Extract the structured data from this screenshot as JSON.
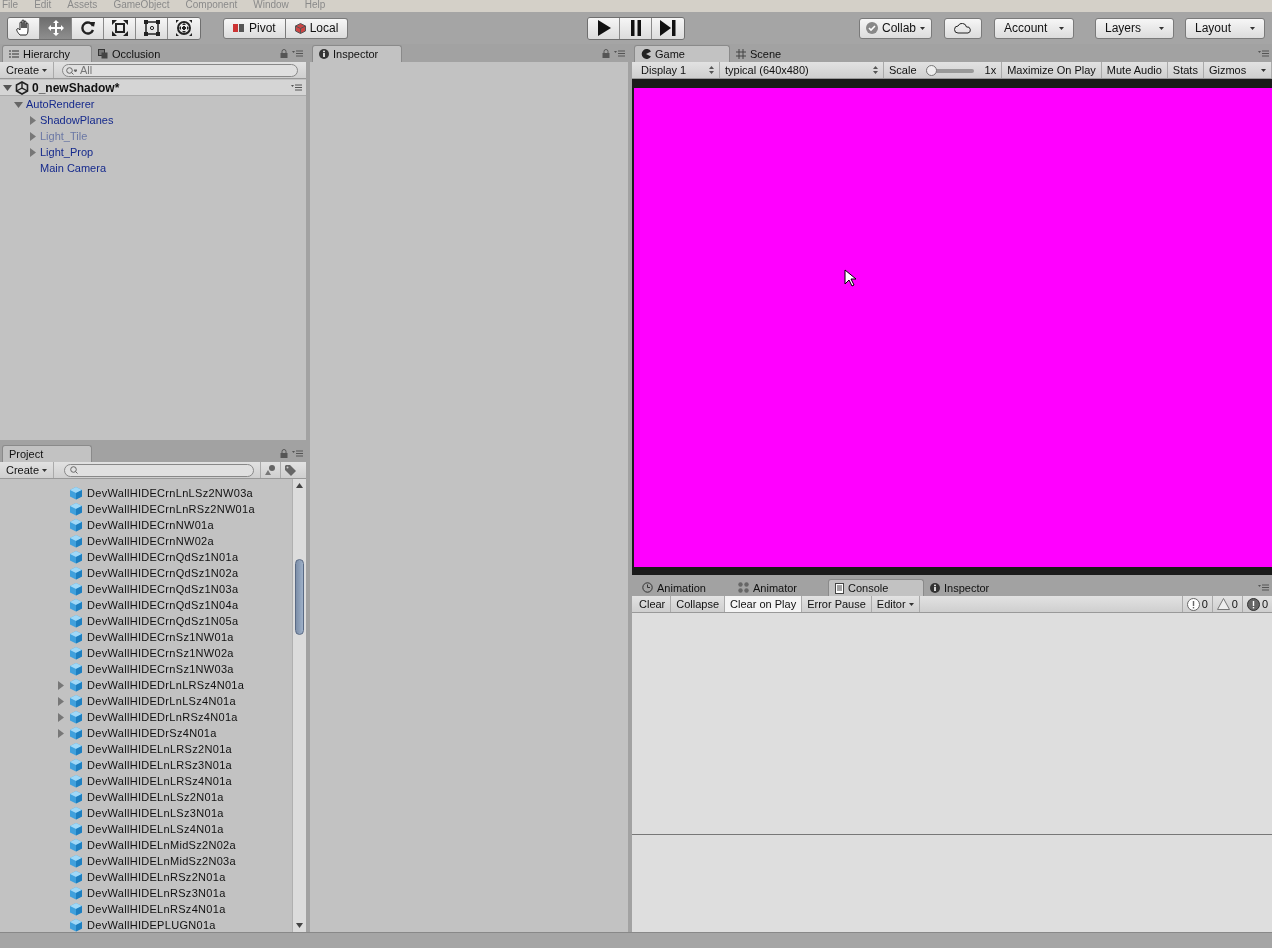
{
  "menu": [
    "File",
    "Edit",
    "Assets",
    "GameObject",
    "Component",
    "Window",
    "Help"
  ],
  "toolbar": {
    "tools": [
      {
        "kind": "hand",
        "selected": false
      },
      {
        "kind": "move",
        "selected": true
      },
      {
        "kind": "rotate",
        "selected": false
      },
      {
        "kind": "scale",
        "selected": false
      },
      {
        "kind": "rect",
        "selected": false
      },
      {
        "kind": "transform",
        "selected": false
      }
    ],
    "pivot": "Pivot",
    "local": "Local",
    "playback": [
      {
        "kind": "play",
        "selected": false
      },
      {
        "kind": "pause",
        "selected": false
      },
      {
        "kind": "step",
        "selected": false
      }
    ],
    "collab": "Collab",
    "account": "Account",
    "layers": "Layers",
    "layout": "Layout"
  },
  "hierarchy": {
    "tabs": [
      {
        "label": "Hierarchy",
        "kind": "list",
        "selected": true
      },
      {
        "label": "Occlusion",
        "kind": "occlusion",
        "selected": false
      }
    ],
    "create": "Create",
    "placeholder": "All",
    "scene": {
      "name": "0_newShadow*",
      "expanded": true,
      "children": [
        {
          "name": "AutoRenderer",
          "kind": "parent",
          "expanded": true,
          "disabled": false,
          "children": [
            {
              "name": "ShadowPlanes",
              "kind": "parent",
              "expanded": false,
              "disabled": false
            },
            {
              "name": "Light_Tile",
              "kind": "parent",
              "expanded": false,
              "disabled": true
            },
            {
              "name": "Light_Prop",
              "kind": "parent",
              "expanded": false,
              "disabled": false
            },
            {
              "name": "Main Camera",
              "kind": "leaf",
              "disabled": false
            }
          ]
        }
      ]
    }
  },
  "project": {
    "tabs": [
      {
        "label": "Project",
        "selected": true
      }
    ],
    "create": "Create",
    "items": [
      {
        "name": "DevWallHIDECrnLnLSz2NW03a",
        "kind": "leaf"
      },
      {
        "name": "DevWallHIDECrnLnRSz2NW01a",
        "kind": "leaf"
      },
      {
        "name": "DevWallHIDECrnNW01a",
        "kind": "leaf"
      },
      {
        "name": "DevWallHIDECrnNW02a",
        "kind": "leaf"
      },
      {
        "name": "DevWallHIDECrnQdSz1N01a",
        "kind": "leaf"
      },
      {
        "name": "DevWallHIDECrnQdSz1N02a",
        "kind": "leaf"
      },
      {
        "name": "DevWallHIDECrnQdSz1N03a",
        "kind": "leaf"
      },
      {
        "name": "DevWallHIDECrnQdSz1N04a",
        "kind": "leaf"
      },
      {
        "name": "DevWallHIDECrnQdSz1N05a",
        "kind": "leaf"
      },
      {
        "name": "DevWallHIDECrnSz1NW01a",
        "kind": "leaf"
      },
      {
        "name": "DevWallHIDECrnSz1NW02a",
        "kind": "leaf"
      },
      {
        "name": "DevWallHIDECrnSz1NW03a",
        "kind": "leaf"
      },
      {
        "name": "DevWallHIDEDrLnLRSz4N01a",
        "kind": "parent",
        "expanded": false
      },
      {
        "name": "DevWallHIDEDrLnLSz4N01a",
        "kind": "parent",
        "expanded": false
      },
      {
        "name": "DevWallHIDEDrLnRSz4N01a",
        "kind": "parent",
        "expanded": false
      },
      {
        "name": "DevWallHIDEDrSz4N01a",
        "kind": "parent",
        "expanded": false
      },
      {
        "name": "DevWallHIDELnLRSz2N01a",
        "kind": "leaf"
      },
      {
        "name": "DevWallHIDELnLRSz3N01a",
        "kind": "leaf"
      },
      {
        "name": "DevWallHIDELnLRSz4N01a",
        "kind": "leaf"
      },
      {
        "name": "DevWallHIDELnLSz2N01a",
        "kind": "leaf"
      },
      {
        "name": "DevWallHIDELnLSz3N01a",
        "kind": "leaf"
      },
      {
        "name": "DevWallHIDELnLSz4N01a",
        "kind": "leaf"
      },
      {
        "name": "DevWallHIDELnMidSz2N02a",
        "kind": "leaf"
      },
      {
        "name": "DevWallHIDELnMidSz2N03a",
        "kind": "leaf"
      },
      {
        "name": "DevWallHIDELnRSz2N01a",
        "kind": "leaf"
      },
      {
        "name": "DevWallHIDELnRSz3N01a",
        "kind": "leaf"
      },
      {
        "name": "DevWallHIDELnRSz4N01a",
        "kind": "leaf"
      },
      {
        "name": "DevWallHIDEPLUGN01a",
        "kind": "leaf"
      }
    ]
  },
  "inspector": {
    "tabs": [
      {
        "label": "Inspector",
        "selected": true
      }
    ]
  },
  "game": {
    "tabs": [
      {
        "label": "Game",
        "kind": "game",
        "selected": true
      },
      {
        "label": "Scene",
        "kind": "scene",
        "selected": false
      }
    ],
    "display": "Display 1",
    "resolution": "typical (640x480)",
    "scale_label": "Scale",
    "scale": {
      "level": 0
    },
    "scale_reading": "1x",
    "toggles": [
      {
        "label": "Maximize On Play",
        "on": false
      },
      {
        "label": "Mute Audio",
        "on": false
      },
      {
        "label": "Stats",
        "on": false
      }
    ],
    "gizmos": "Gizmos"
  },
  "console": {
    "tabs": [
      {
        "label": "Animation",
        "kind": "clock",
        "selected": false
      },
      {
        "label": "Animator",
        "kind": "nodes",
        "selected": false
      },
      {
        "label": "Console",
        "kind": "console",
        "selected": true
      },
      {
        "label": "Inspector",
        "kind": "info",
        "selected": false
      }
    ],
    "toggles": [
      {
        "label": "Clear",
        "on": false
      },
      {
        "label": "Collapse",
        "on": false
      },
      {
        "label": "Clear on Play",
        "on": true
      },
      {
        "label": "Error Pause",
        "on": false
      }
    ],
    "editor": "Editor",
    "counts": [
      {
        "kind": "info",
        "value": "0"
      },
      {
        "kind": "warning",
        "value": "0"
      },
      {
        "kind": "error",
        "value": "0"
      }
    ]
  }
}
